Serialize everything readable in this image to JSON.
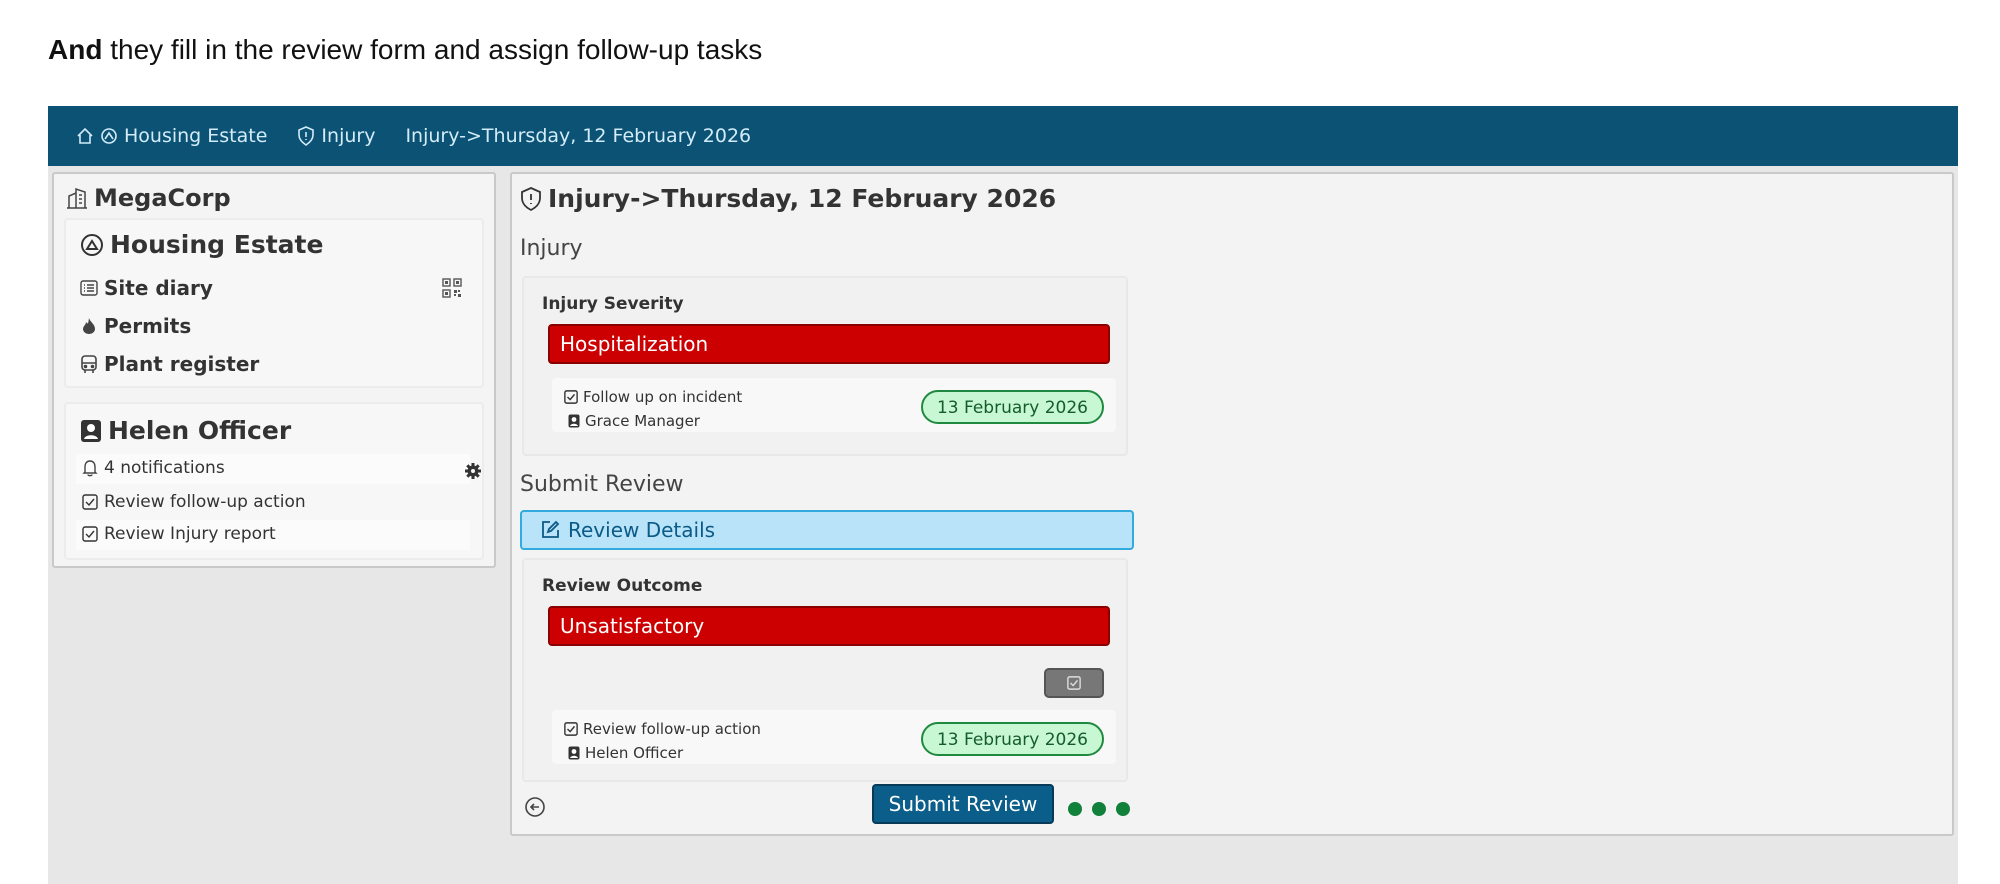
{
  "caption": {
    "bold": "And",
    "rest": " they fill in the review form and assign follow-up tasks"
  },
  "breadcrumbs": {
    "home_icon": "home-icon",
    "estate": "Housing Estate",
    "injury": "Injury",
    "current": "Injury->Thursday, 12 February 2026"
  },
  "sidebar": {
    "org": "MegaCorp",
    "site": {
      "title": "Housing Estate",
      "items": [
        {
          "label": "Site diary",
          "icon": "list-icon"
        },
        {
          "label": "Permits",
          "icon": "fire-icon"
        },
        {
          "label": "Plant register",
          "icon": "bus-icon"
        }
      ]
    },
    "user": {
      "name": "Helen Officer",
      "notifications": "4 notifications",
      "tasks": [
        "Review follow-up action",
        "Review Injury report"
      ]
    }
  },
  "main": {
    "title": "Injury->Thursday, 12 February 2026",
    "section_injury": "Injury",
    "severity_label": "Injury Severity",
    "severity_value": "Hospitalization",
    "task1": {
      "title": "Follow up on incident",
      "assignee": "Grace Manager",
      "date": "13 February 2026"
    },
    "section_review": "Submit Review",
    "details_label": "Review Details",
    "outcome_label": "Review Outcome",
    "outcome_value": "Unsatisfactory",
    "task2": {
      "title": "Review follow-up action",
      "assignee": "Helen Officer",
      "date": "13 February 2026"
    },
    "submit_label": "Submit Review"
  },
  "colors": {
    "topbar": "#0b5275",
    "danger": "#cc0000",
    "accent": "#b8e3f8",
    "success_pill": "#c8f7d4",
    "primary": "#0b5e8a"
  }
}
